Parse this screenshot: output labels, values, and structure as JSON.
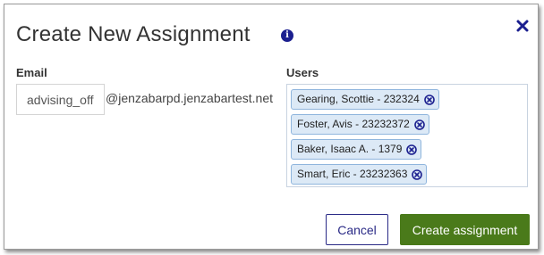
{
  "dialog": {
    "title": "Create New Assignment",
    "info_icon": "info-circle-icon",
    "close_icon": "close-x-icon"
  },
  "email": {
    "label": "Email",
    "value": "advising_off",
    "domain": "@jenzabarpd.jenzabartest.net"
  },
  "users": {
    "label": "Users",
    "selected": [
      "Gearing, Scottie - 232324",
      "Foster, Avis - 23232372",
      "Baker, Isaac A. - 1379",
      "Smart, Eric - 23232363"
    ],
    "remove_icon": "remove-circle-icon"
  },
  "actions": {
    "cancel_label": "Cancel",
    "create_label": "Create assignment"
  },
  "colors": {
    "accent": "#1b1f8f",
    "primary_button": "#4a7a1a",
    "tag_background": "#dce9f6",
    "tag_border": "#8fb5dd"
  }
}
